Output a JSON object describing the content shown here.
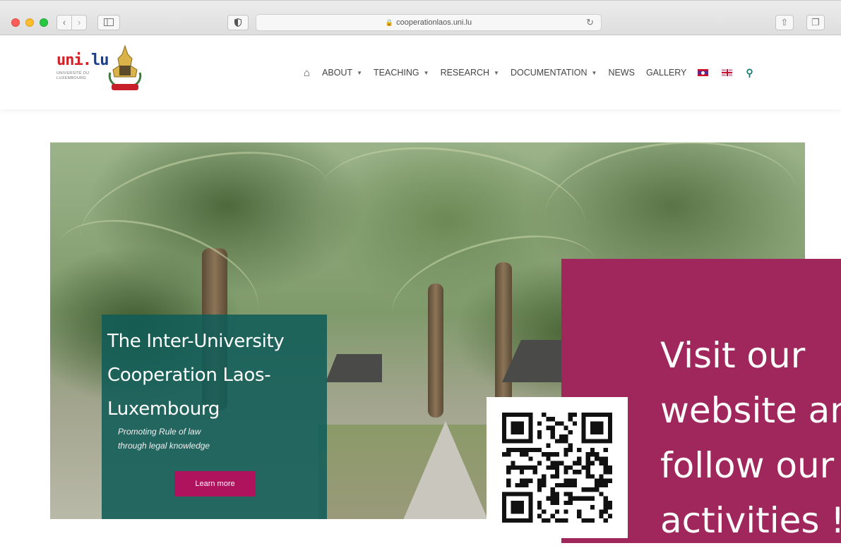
{
  "browser": {
    "url": "cooperationlaos.uni.lu"
  },
  "header": {
    "logo": {
      "text_red": "uni.",
      "text_blue": "lu",
      "sub_line1": "UNIVERSITÉ DU",
      "sub_line2": "LUXEMBOURG"
    },
    "nav": [
      {
        "label": "ABOUT",
        "dropdown": true
      },
      {
        "label": "TEACHING",
        "dropdown": true
      },
      {
        "label": "RESEARCH",
        "dropdown": true
      },
      {
        "label": "DOCUMENTATION",
        "dropdown": true
      },
      {
        "label": "NEWS",
        "dropdown": false
      },
      {
        "label": "GALLERY",
        "dropdown": false
      }
    ],
    "icons": [
      "home-icon",
      "flag-lao-icon",
      "flag-uk-icon",
      "search-icon"
    ]
  },
  "hero": {
    "title": "The Inter-University Cooperation Laos-Luxembourg",
    "subtitle_line1": "Promoting Rule of law",
    "subtitle_line2": "through legal knowledge",
    "button_label": "Learn more"
  },
  "poster": {
    "line1": "Visit our",
    "line2": "website and",
    "line3": "follow our",
    "line4": "activities !"
  },
  "colors": {
    "teal_card": "#105c58",
    "learn_button": "#b0135d",
    "poster_bg": "#a0275c",
    "uni_red": "#d2232a",
    "uni_blue": "#1b3e8c"
  }
}
